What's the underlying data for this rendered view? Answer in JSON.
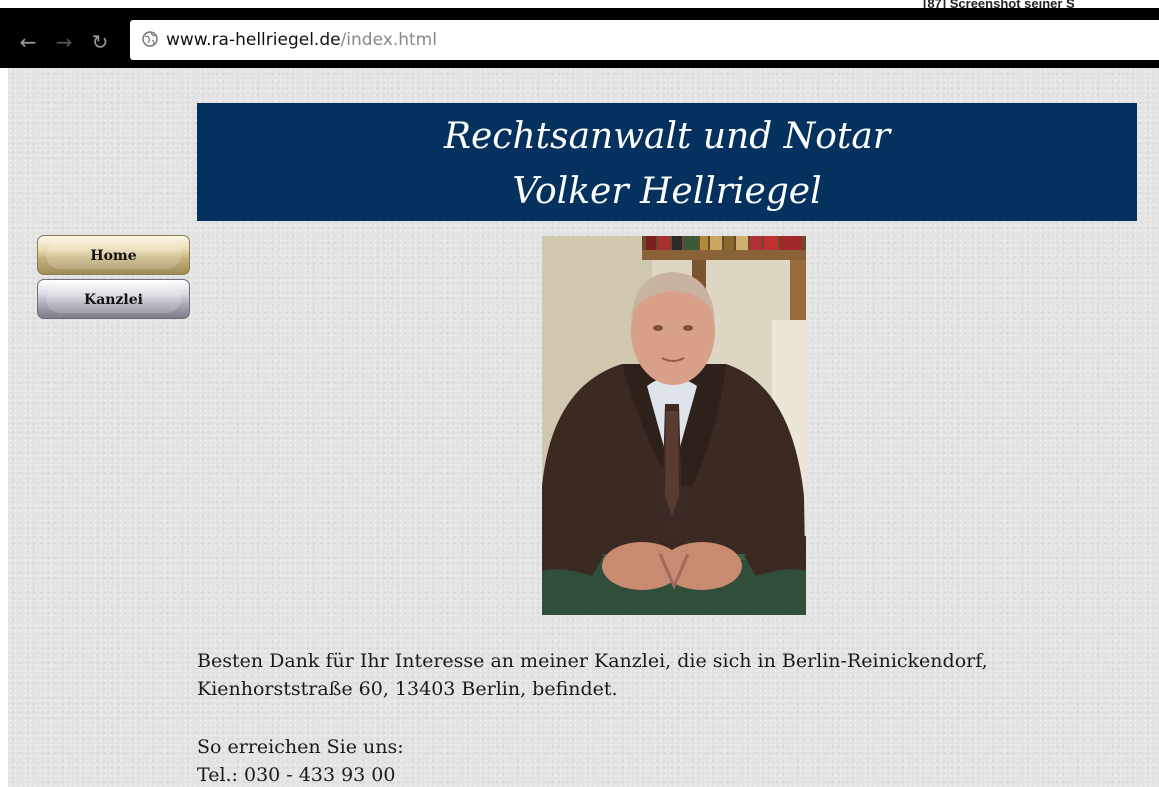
{
  "corner_caption": "[87] Screenshot seiner S",
  "browser": {
    "url_host": "www.ra-hellriegel.de",
    "url_path": "/index.html"
  },
  "header": {
    "line1": "Rechtsanwalt und Notar",
    "line2": "Volker Hellriegel"
  },
  "nav": {
    "items": [
      {
        "label": "Home"
      },
      {
        "label": "Kanzlei"
      }
    ]
  },
  "content": {
    "para1_line1": "Besten Dank für Ihr Interesse an meiner Kanzlei, die sich in Berlin-Reinickendorf,",
    "para1_line2": "Kienhorststraße 60, 13403 Berlin, befindet.",
    "contact_heading": "So erreichen Sie uns:",
    "phone": "Tel.: 030 - 433 93 00"
  },
  "colors": {
    "banner": "#05315e",
    "page_background": "#e3e3e3",
    "toolbar": "#000000"
  }
}
